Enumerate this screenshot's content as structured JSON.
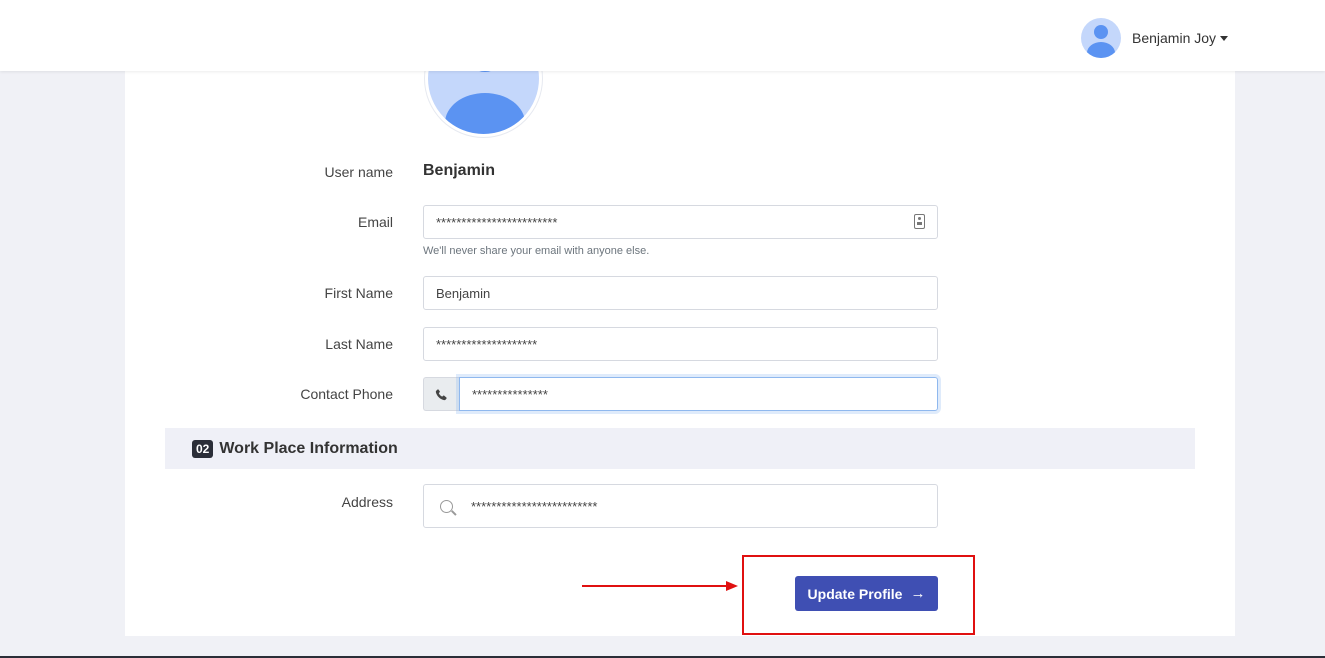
{
  "header": {
    "user_name": "Benjamin Joy"
  },
  "profile": {
    "username_label": "User name",
    "username_value": "Benjamin",
    "email_label": "Email",
    "email_value": "************************",
    "email_help": "We'll never share your email with anyone else.",
    "first_name_label": "First Name",
    "first_name_value": "Benjamin",
    "last_name_label": "Last Name",
    "last_name_value": "********************",
    "contact_phone_label": "Contact Phone",
    "contact_phone_value": "***************"
  },
  "workplace": {
    "section_number": "02",
    "section_title": "Work Place Information",
    "address_label": "Address",
    "address_value": "*************************"
  },
  "actions": {
    "update_label": "Update Profile",
    "update_arrow": "→"
  },
  "colors": {
    "primary": "#3f4fb3",
    "annotation": "#e01010",
    "avatar_bg": "#c4d7fb",
    "avatar_fg": "#5b93f2"
  }
}
